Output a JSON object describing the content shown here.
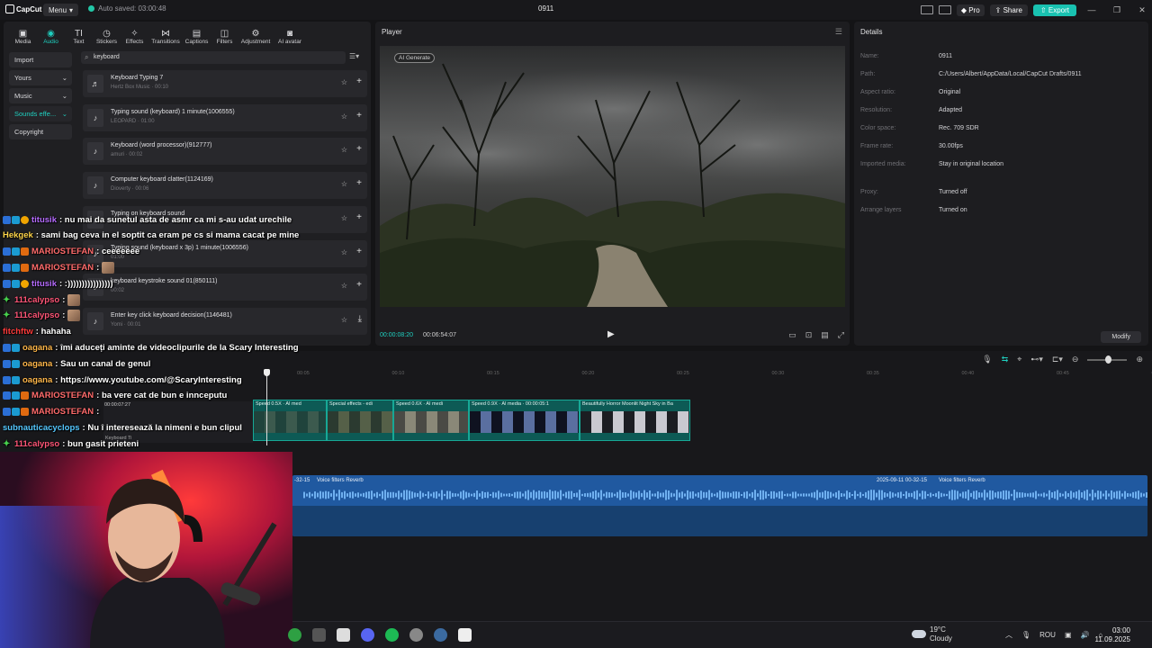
{
  "titlebar": {
    "app_name": "CapCut",
    "menu_label": "Menu",
    "autosave_text": "Auto saved: 03:00:48",
    "project_title": "0911",
    "pro_label": "Pro",
    "share_label": "Share",
    "export_label": "Export"
  },
  "media": {
    "tabs": [
      {
        "label": "Media",
        "icon": "media-icon"
      },
      {
        "label": "Audio",
        "icon": "audio-icon"
      },
      {
        "label": "Text",
        "icon": "text-icon"
      },
      {
        "label": "Stickers",
        "icon": "stickers-icon"
      },
      {
        "label": "Effects",
        "icon": "effects-icon"
      },
      {
        "label": "Transitions",
        "icon": "transitions-icon"
      },
      {
        "label": "Captions",
        "icon": "captions-icon"
      },
      {
        "label": "Filters",
        "icon": "filters-icon"
      },
      {
        "label": "Adjustment",
        "icon": "adjustment-icon"
      },
      {
        "label": "AI avatar",
        "icon": "ai-avatar-icon"
      }
    ],
    "active_tab": "Audio",
    "categories": [
      {
        "label": "Import"
      },
      {
        "label": "Yours"
      },
      {
        "label": "Music"
      },
      {
        "label": "Sounds effe..."
      },
      {
        "label": "Copyright"
      }
    ],
    "search_value": "keyboard",
    "sounds": [
      {
        "title": "Keyboard Typing 7",
        "sub": "Hertz Box Music · 00:10"
      },
      {
        "title": "Typing sound (keyboard) 1 minute(1006555)",
        "sub": "LEOPARD · 01:00"
      },
      {
        "title": "Keyboard (word processor)(912777)",
        "sub": "amuri · 00:02"
      },
      {
        "title": "Computer keyboard clatter(1124169)",
        "sub": "Dioverty · 00:06"
      },
      {
        "title": "Typing on keyboard sound",
        "sub": ""
      },
      {
        "title": "Typing sound (keyboard x 3p) 1 minute(1006556)",
        "sub": "01:00"
      },
      {
        "title": "keyboard keystroke sound 01(850111)",
        "sub": "00:02"
      },
      {
        "title": "Enter key click keyboard decision(1146481)",
        "sub": "Yomi · 00:01"
      }
    ]
  },
  "player": {
    "title": "Player",
    "ai_tag": "AI Generate",
    "time_current": "00:00:08:20",
    "time_total": "00:06:54:07"
  },
  "details": {
    "title": "Details",
    "rows": [
      {
        "key": "Name:",
        "value": "0911"
      },
      {
        "key": "Path:",
        "value": "C:/Users/Albert/AppData/Local/CapCut Drafts/0911"
      },
      {
        "key": "Aspect ratio:",
        "value": "Original"
      },
      {
        "key": "Resolution:",
        "value": "Adapted"
      },
      {
        "key": "Color space:",
        "value": "Rec. 709 SDR"
      },
      {
        "key": "Frame rate:",
        "value": "30.00fps"
      },
      {
        "key": "Imported media:",
        "value": "Stay in original location"
      },
      {
        "key": "Proxy:",
        "value": "Turned off"
      },
      {
        "key": "Arrange layers",
        "value": "Turned on"
      }
    ],
    "modify_label": "Modify"
  },
  "timeline": {
    "ruler_ticks": [
      "00:05",
      "00:10",
      "00:15",
      "00:20",
      "00:25",
      "00:30",
      "00:35",
      "00:40",
      "00:45",
      "00:50"
    ],
    "cover_time": "00:00:07:27",
    "cover_label": "Keyboard Ti",
    "clips": [
      {
        "label": "Speed 0.5X · AI med"
      },
      {
        "label": "Special effects - edi"
      },
      {
        "label": "Speed 0.6X · AI medi"
      },
      {
        "label": "Speed 0.9X · AI media · 00:00:05:1"
      },
      {
        "label": "Beautifully Horror Moonlit Night Sky in Ba"
      }
    ],
    "audio_labels": [
      {
        "text": "-32-15"
      },
      {
        "text": "Voice filters Reverb"
      },
      {
        "text": "2025-09-11 00-32-15"
      },
      {
        "text": "Voice filters Reverb"
      }
    ]
  },
  "chat": [
    {
      "user": "titusik",
      "color": "#b66cff",
      "msg": ": nu mai da sunetul asta de asmr ca mi s-au udat urechile",
      "badges": [
        "b1",
        "b2",
        "b3"
      ],
      "vip": false
    },
    {
      "user": "Hekgek",
      "color": "#ffd54a",
      "msg": ": sami bag ceva in el soptit ca eram pe cs si mama cacat pe mine",
      "badges": [],
      "vip": false
    },
    {
      "user": "MARIOSTEFAN",
      "color": "#ff6b6b",
      "msg": ": ceeeeeee",
      "badges": [
        "b1",
        "b2",
        "b4"
      ],
      "vip": false
    },
    {
      "user": "MARIOSTEFAN",
      "color": "#ff6b6b",
      "msg": ":",
      "badges": [
        "b1",
        "b2",
        "b4"
      ],
      "vip": false,
      "emote": true
    },
    {
      "user": "titusik",
      "color": "#b66cff",
      "msg": ": :))))))))))))))))",
      "badges": [
        "b1",
        "b2",
        "b3"
      ],
      "vip": false
    },
    {
      "user": "111calypso",
      "color": "#ff5577",
      "msg": ":",
      "badges": [],
      "vip": true,
      "emote": true
    },
    {
      "user": "111calypso",
      "color": "#ff5577",
      "msg": ":",
      "badges": [],
      "vip": true,
      "emote": true
    },
    {
      "user": "fitchftw",
      "color": "#ff3b3b",
      "msg": ": hahaha",
      "badges": [],
      "vip": false
    },
    {
      "user": "oagana",
      "color": "#ffb74a",
      "msg": ": îmi aduceți aminte de videoclipurile de la Scary Interesting",
      "badges": [
        "b1",
        "b2"
      ],
      "vip": false
    },
    {
      "user": "oagana",
      "color": "#ffb74a",
      "msg": ": Sau un canal de genul",
      "badges": [
        "b1",
        "b2"
      ],
      "vip": false
    },
    {
      "user": "oagana",
      "color": "#ffb74a",
      "msg": ": https://www.youtube.com/@ScaryInteresting",
      "badges": [
        "b1",
        "b2"
      ],
      "vip": false
    },
    {
      "user": "MARIOSTEFAN",
      "color": "#ff6b6b",
      "msg": ": ba vere cat de bun e innceputu",
      "badges": [
        "b1",
        "b2",
        "b4"
      ],
      "vip": false
    },
    {
      "user": "MARIOSTEFAN",
      "color": "#ff6b6b",
      "msg": ":",
      "badges": [
        "b1",
        "b2",
        "b4"
      ],
      "vip": false
    },
    {
      "user": "subnauticacyclops",
      "color": "#55c8ff",
      "msg": ": Nu î interesează la nimeni e bun clipul",
      "badges": [],
      "vip": false
    },
    {
      "user": "111calypso",
      "color": "#ff5577",
      "msg": ": bun gasit prieteni",
      "badges": [],
      "vip": true
    }
  ],
  "taskbar": {
    "weather_temp": "19°C",
    "weather_desc": "Cloudy",
    "lang": "ROU",
    "time": "03:00",
    "date": "11.09.2025"
  },
  "colors": {
    "accent": "#1fd0c0",
    "export": "#19c2b1",
    "audio_track": "#2059a0",
    "video_clip": "#0d5a55"
  }
}
